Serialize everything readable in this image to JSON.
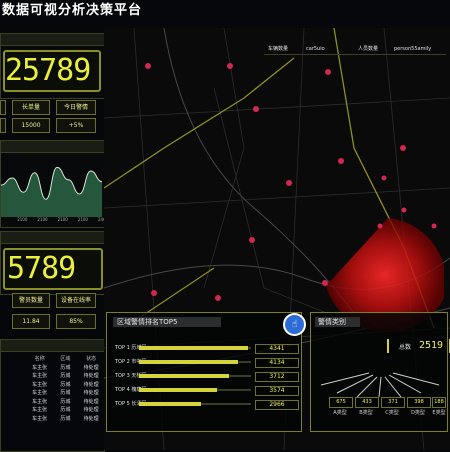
{
  "app": {
    "title": "数据可视分析决策平台"
  },
  "left_top": {
    "total": "25789",
    "stat_labels": [
      "",
      "长单量",
      "今日警情"
    ],
    "stat_values": [
      "",
      "15000",
      "+5%"
    ]
  },
  "area_chart": {
    "x_ticks": [
      "0",
      "2100",
      "2100",
      "2100",
      "2100",
      "2400"
    ],
    "values": [
      38,
      42,
      34,
      45,
      30,
      48,
      41,
      33,
      46,
      40
    ]
  },
  "left_mid": {
    "total": "5789",
    "stat_labels": [
      "警员数量",
      "设备在线率"
    ],
    "stat_values": [
      "11.84",
      "85%"
    ]
  },
  "table": {
    "headers": [
      "",
      "名称",
      "区域",
      "状态"
    ],
    "rows": [
      [
        "",
        "车主张",
        "历城",
        "待处理"
      ],
      [
        "",
        "车主张",
        "历城",
        "待处理"
      ],
      [
        "",
        "车主张",
        "历城",
        "待处理"
      ],
      [
        "",
        "车主张",
        "历城",
        "待处理"
      ],
      [
        "",
        "车主张",
        "历城",
        "待处理"
      ],
      [
        "",
        "车主张",
        "历城",
        "待处理"
      ],
      [
        "",
        "车主张",
        "历城",
        "待处理"
      ]
    ]
  },
  "info_bar": {
    "cells": [
      "车辆数量",
      "car5uio",
      "人员数量",
      "person55amily"
    ]
  },
  "ranking": {
    "title": "区域警情排名TOP5",
    "items": [
      {
        "label": "TOP 1 历城区",
        "value": "4341",
        "fraction": 0.97
      },
      {
        "label": "TOP 2 市中区",
        "value": "4134",
        "fraction": 0.88
      },
      {
        "label": "TOP 3 天桥区",
        "value": "3712",
        "fraction": 0.8
      },
      {
        "label": "TOP 4 槐荫区",
        "value": "3574",
        "fraction": 0.7
      },
      {
        "label": "TOP 5 长清区",
        "value": "2966",
        "fraction": 0.55
      }
    ]
  },
  "alerts": {
    "title": "警情类别",
    "total_label": "总数",
    "total": "2519",
    "values": [
      "675",
      "433",
      "371",
      "398",
      "188"
    ],
    "labels": [
      "A类型",
      "B类型",
      "C类型",
      "D类型",
      "E类型"
    ]
  },
  "colors": {
    "accent": "#eaf03a",
    "heat": "#e01b1b",
    "badge": "#2d6cd6"
  }
}
